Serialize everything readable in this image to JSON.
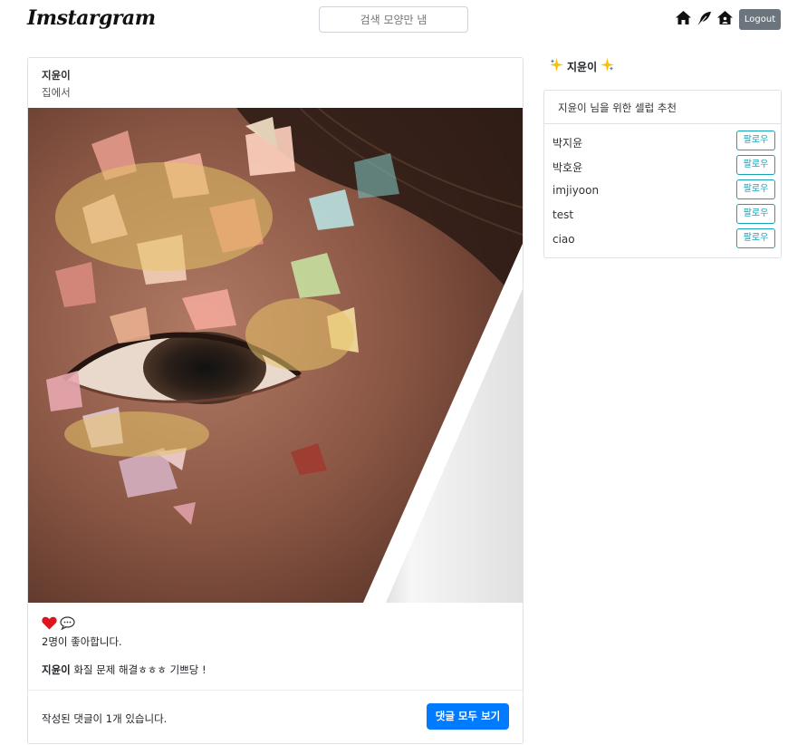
{
  "navbar": {
    "brand": "Imstargram",
    "search_placeholder": "검색 모양만 냄",
    "icons": [
      "home-icon",
      "feather-icon",
      "house-user-icon"
    ],
    "logout_label": "Logout"
  },
  "post": {
    "author": "지윤이",
    "location": "집에서",
    "image_description_icon": "glitter-eye-photo",
    "like_icon": "heart-icon",
    "comment_icon": "speech-bubble-icon",
    "likes_text": "2명이 좋아합니다.",
    "caption_author": "지윤이",
    "caption_text": " 화질 문제 해결ㅎㅎㅎ 기쁘당 !",
    "comment_count_text": "작성된 댓글이 1개 있습니다.",
    "view_comments_label": "댓글 모두 보기"
  },
  "sidebar": {
    "user_name": "지윤이",
    "user_decoration_icon": "sparkle-icon",
    "recommend_title": "지윤이 님을 위한 셀럽 추천",
    "follow_label": "팔로우",
    "recommendations": [
      "박지윤",
      "박호윤",
      "imjiyoon",
      "test",
      "ciao"
    ]
  },
  "colors": {
    "primary": "#007bff",
    "info": "#17a2b8",
    "secondary": "#6c757d",
    "heart": "#e0141e"
  }
}
